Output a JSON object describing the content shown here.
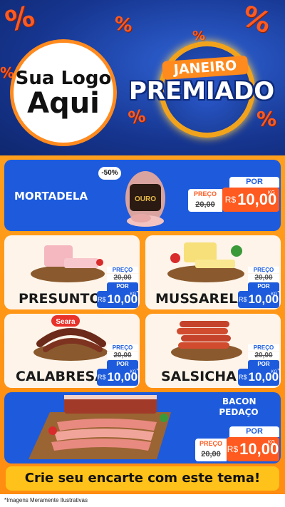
{
  "header": {
    "logo_line1": "Sua Logo",
    "logo_line2": "Aqui",
    "badge_top": "JANEIRO",
    "badge_main": "PREMIADO"
  },
  "colors": {
    "blue": "#1d5bdc",
    "orange": "#ff8c10",
    "red_orange": "#ff5a1f",
    "yellow": "#ffc21a"
  },
  "products": {
    "mortadela": {
      "name": "MORTADELA",
      "discount": "-50%",
      "brand": "OURO",
      "price_label": "PREÇO",
      "old_price": "20,00",
      "por_label": "POR",
      "currency": "R$",
      "price": "10,00",
      "unit": "KG"
    },
    "presunto": {
      "name": "PRESUNTO",
      "price_label": "PREÇO",
      "old_price": "20,00",
      "por_label": "POR",
      "currency": "R$",
      "price": "10,00",
      "unit": "KG"
    },
    "mussarela": {
      "name": "MUSSARELA",
      "price_label": "PREÇO",
      "old_price": "20,00",
      "por_label": "POR",
      "currency": "R$",
      "price": "10,00",
      "unit": "KG"
    },
    "calabresa": {
      "name": "CALABRESA",
      "brand": "Seara",
      "price_label": "PREÇO",
      "old_price": "20,00",
      "por_label": "POR",
      "currency": "R$",
      "price": "10,00",
      "unit": "KG"
    },
    "salsicha": {
      "name": "SALSICHA",
      "price_label": "PREÇO",
      "old_price": "20,00",
      "por_label": "POR",
      "currency": "R$",
      "price": "10,00",
      "unit": "KG"
    },
    "bacon": {
      "name_line1": "BACON",
      "name_line2": "PEDAÇO",
      "price_label": "PREÇO",
      "old_price": "20,00",
      "por_label": "POR",
      "currency": "R$",
      "price": "10,00",
      "unit": "KG"
    }
  },
  "footer": {
    "cta": "Crie seu encarte com este tema!",
    "disclaimer": "*Imagens Meramente Ilustrativas"
  }
}
